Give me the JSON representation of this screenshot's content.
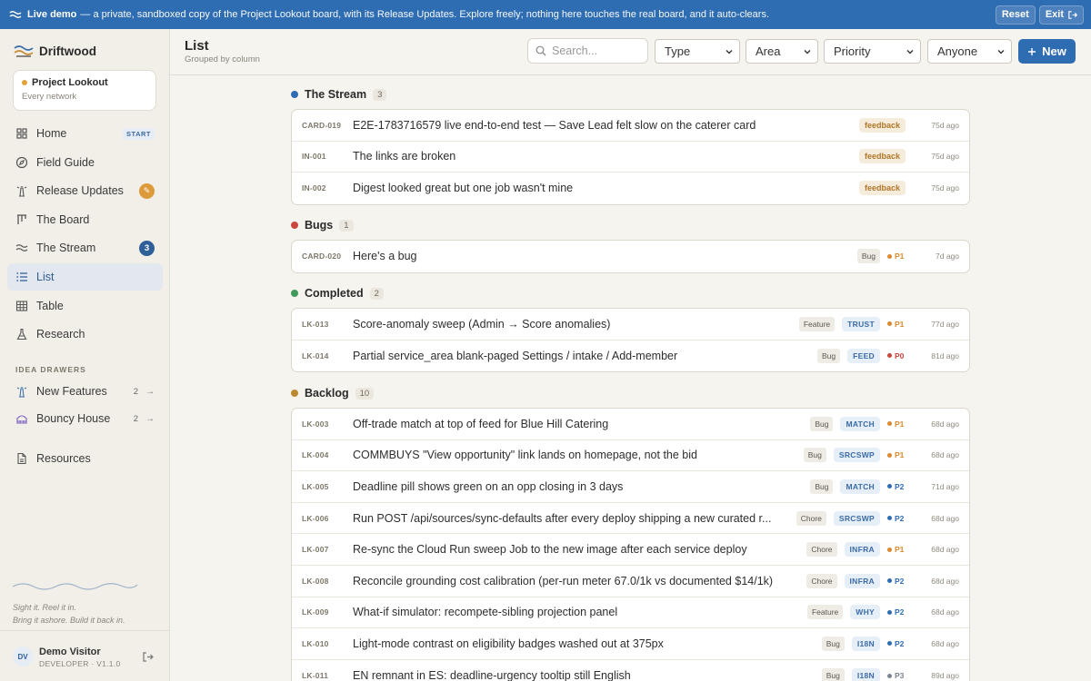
{
  "banner": {
    "strong": "Live demo",
    "text": "— a private, sandboxed copy of the Project Lookout board, with its Release Updates. Explore freely; nothing here touches the real board, and it auto-clears.",
    "reset_label": "Reset",
    "exit_label": "Exit"
  },
  "sidebar": {
    "brand": "Driftwood",
    "project": {
      "name": "Project Lookout",
      "sub": "Every network"
    },
    "nav": [
      {
        "label": "Home",
        "tag": "START",
        "icon": "home-grid-icon"
      },
      {
        "label": "Field Guide",
        "icon": "compass-icon"
      },
      {
        "label": "Release Updates",
        "badge": "✎",
        "icon": "lighthouse-icon"
      },
      {
        "label": "The Board",
        "icon": "board-icon"
      },
      {
        "label": "The Stream",
        "badge": "3",
        "icon": "wave-icon"
      },
      {
        "label": "List",
        "icon": "list-icon"
      },
      {
        "label": "Table",
        "icon": "table-icon"
      },
      {
        "label": "Research",
        "icon": "flask-icon"
      }
    ],
    "drawers_label": "IDEA DRAWERS",
    "drawers": [
      {
        "label": "New Features",
        "count": "2",
        "icon": "lighthouse-icon"
      },
      {
        "label": "Bouncy House",
        "count": "2",
        "icon": "bouncy-house-icon"
      }
    ],
    "resources_label": "Resources",
    "tagline_1": "Sight it. Reel it in.",
    "tagline_2": "Bring it ashore. Build it back in.",
    "user": {
      "initials": "DV",
      "name": "Demo Visitor",
      "role": "DEVELOPER · V1.1.0"
    }
  },
  "header": {
    "title": "List",
    "subtitle": "Grouped by column",
    "search_placeholder": "Search...",
    "filters": {
      "type": "Type",
      "area": "Area",
      "priority": "Priority",
      "assignee": "Anyone"
    },
    "new_label": "New"
  },
  "colors": {
    "accent": "#2f6db3",
    "stream": "#2f6db3",
    "bugs": "#c9473d",
    "completed": "#3f9a5b",
    "backlog": "#b98a2f",
    "p0": "#c9473d",
    "p1": "#d98a2a",
    "p2": "#2f6db3",
    "p3": "#7b8590"
  },
  "groups": [
    {
      "name": "The Stream",
      "count": "3",
      "color": "#2f6db3",
      "cards": [
        {
          "id": "CARD-019",
          "title": "E2E-1783716579 live end-to-end test — Save Lead felt slow on the caterer card",
          "feedback": "feedback",
          "time": "75d ago"
        },
        {
          "id": "IN-001",
          "title": "The links are broken",
          "feedback": "feedback",
          "time": "75d ago"
        },
        {
          "id": "IN-002",
          "title": "Digest looked great but one job wasn't mine",
          "feedback": "feedback",
          "time": "75d ago"
        }
      ]
    },
    {
      "name": "Bugs",
      "count": "1",
      "color": "#c9473d",
      "cards": [
        {
          "id": "CARD-020",
          "title": "Here's a bug",
          "type": "Bug",
          "priority": "P1",
          "time": "7d ago"
        }
      ]
    },
    {
      "name": "Completed",
      "count": "2",
      "color": "#3f9a5b",
      "cards": [
        {
          "id": "LK-013",
          "title": "Score-anomaly sweep (Admin → Score anomalies)",
          "type": "Feature",
          "area": "TRUST",
          "priority": "P1",
          "time": "77d ago"
        },
        {
          "id": "LK-014",
          "title": "Partial service_area blank-paged Settings / intake / Add-member",
          "type": "Bug",
          "area": "FEED",
          "priority": "P0",
          "time": "81d ago"
        }
      ]
    },
    {
      "name": "Backlog",
      "count": "10",
      "color": "#b98a2f",
      "cards": [
        {
          "id": "LK-003",
          "title": "Off-trade match at top of feed for Blue Hill Catering",
          "type": "Bug",
          "area": "MATCH",
          "priority": "P1",
          "time": "68d ago"
        },
        {
          "id": "LK-004",
          "title": "COMMBUYS \"View opportunity\" link lands on homepage, not the bid",
          "type": "Bug",
          "area": "SRCSWP",
          "priority": "P1",
          "time": "68d ago"
        },
        {
          "id": "LK-005",
          "title": "Deadline pill shows green on an opp closing in 3 days",
          "type": "Bug",
          "area": "MATCH",
          "priority": "P2",
          "time": "71d ago"
        },
        {
          "id": "LK-006",
          "title": "Run POST /api/sources/sync-defaults after every deploy shipping a new curated r...",
          "type": "Chore",
          "area": "SRCSWP",
          "priority": "P2",
          "time": "68d ago"
        },
        {
          "id": "LK-007",
          "title": "Re-sync the Cloud Run sweep Job to the new image after each service deploy",
          "type": "Chore",
          "area": "INFRA",
          "priority": "P1",
          "time": "68d ago"
        },
        {
          "id": "LK-008",
          "title": "Reconcile grounding cost calibration (per-run meter 67.0/1k vs documented $14/1k)",
          "type": "Chore",
          "area": "INFRA",
          "priority": "P2",
          "time": "68d ago"
        },
        {
          "id": "LK-009",
          "title": "What-if simulator: recompete-sibling projection panel",
          "type": "Feature",
          "area": "WHY",
          "priority": "P2",
          "time": "68d ago"
        },
        {
          "id": "LK-010",
          "title": "Light-mode contrast on eligibility badges washed out at 375px",
          "type": "Bug",
          "area": "I18N",
          "priority": "P2",
          "time": "68d ago"
        },
        {
          "id": "LK-011",
          "title": "EN remnant in ES: deadline-urgency tooltip still English",
          "type": "Bug",
          "area": "I18N",
          "priority": "P3",
          "time": "89d ago"
        }
      ]
    }
  ]
}
